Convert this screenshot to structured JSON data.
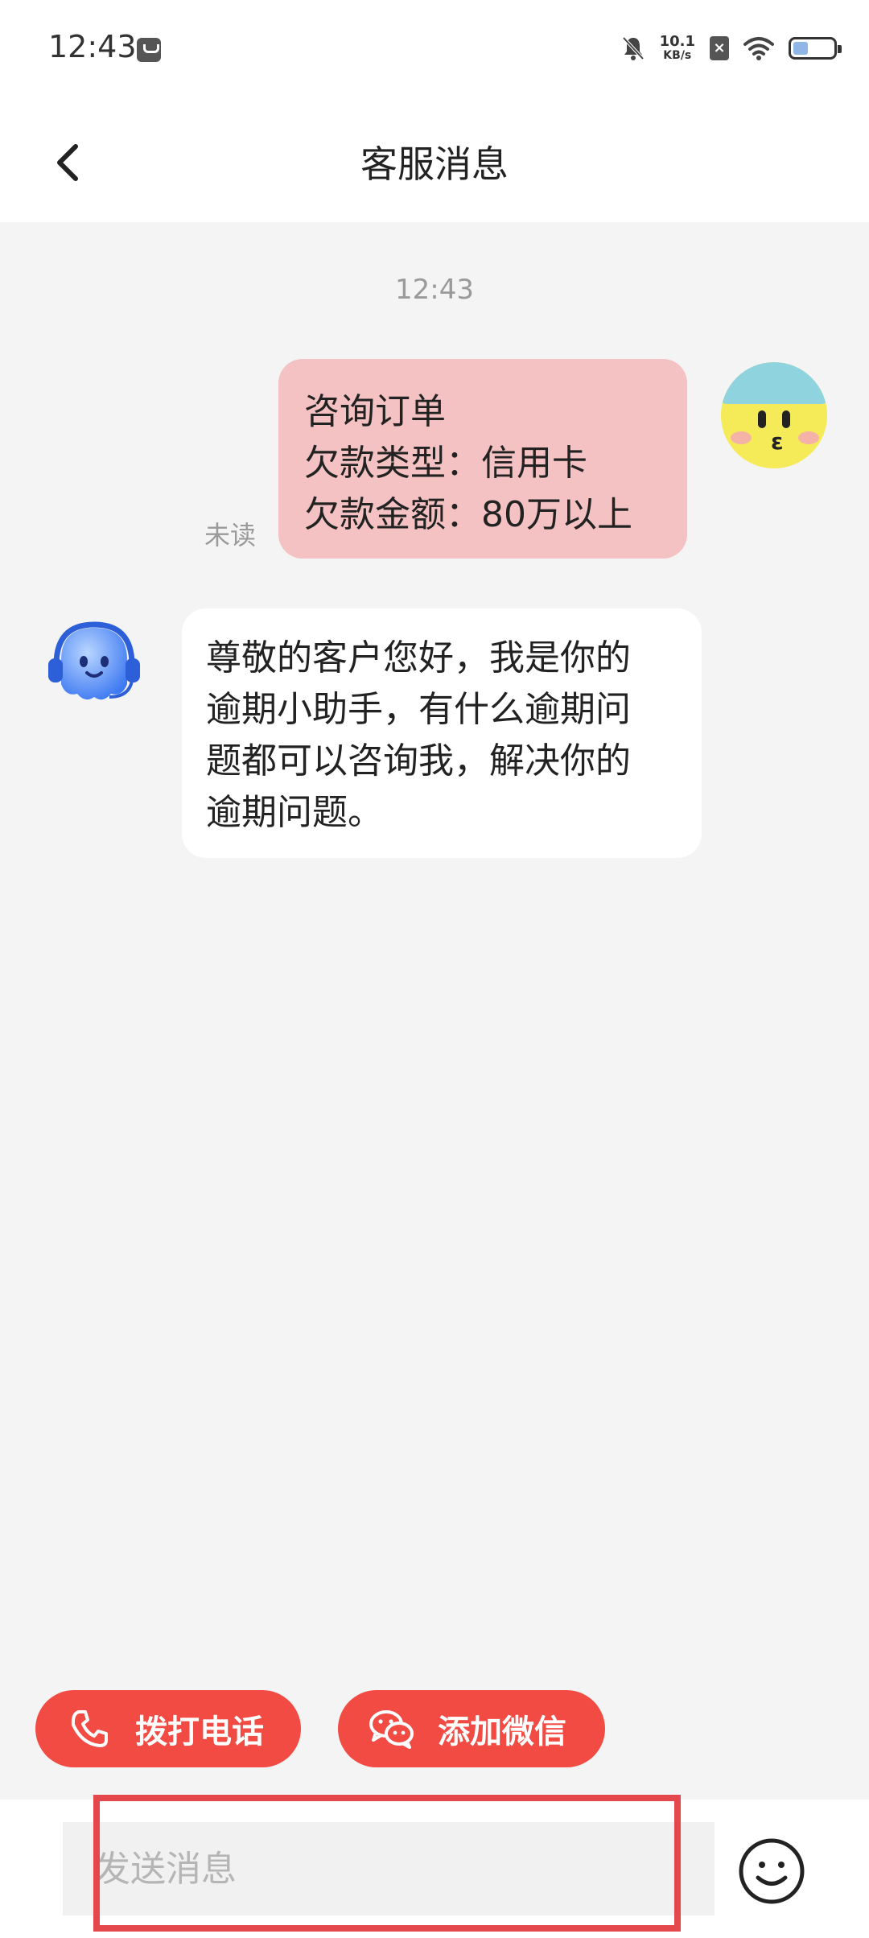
{
  "status_bar": {
    "time": "12:43",
    "net_speed_value": "10.1",
    "net_speed_unit": "KB/s",
    "sim_mark": "×",
    "icons": [
      "message-icon",
      "bell-off-icon",
      "sim-icon",
      "wifi-icon",
      "battery-icon"
    ]
  },
  "header": {
    "title": "客服消息",
    "back_icon": "chevron-left-icon"
  },
  "chat": {
    "timestamp": "12:43",
    "user_message": {
      "lines": [
        "咨询订单",
        "欠款类型：信用卡",
        "欠款金额：80万以上"
      ],
      "status": "未读",
      "bubble_color": "#f4c2c2"
    },
    "agent_message": {
      "lines": [
        "尊敬的客户您好，我是你的",
        "逾期小助手，有什么逾期问",
        "题都可以咨询我，解决你的",
        "逾期问题。"
      ],
      "bubble_color": "#ffffff"
    }
  },
  "quick_actions": {
    "call_label": "拨打电话",
    "wechat_label": "添加微信",
    "color": "#f24b43"
  },
  "input": {
    "placeholder": "发送消息",
    "value": ""
  },
  "highlight_color": "#e5484c"
}
